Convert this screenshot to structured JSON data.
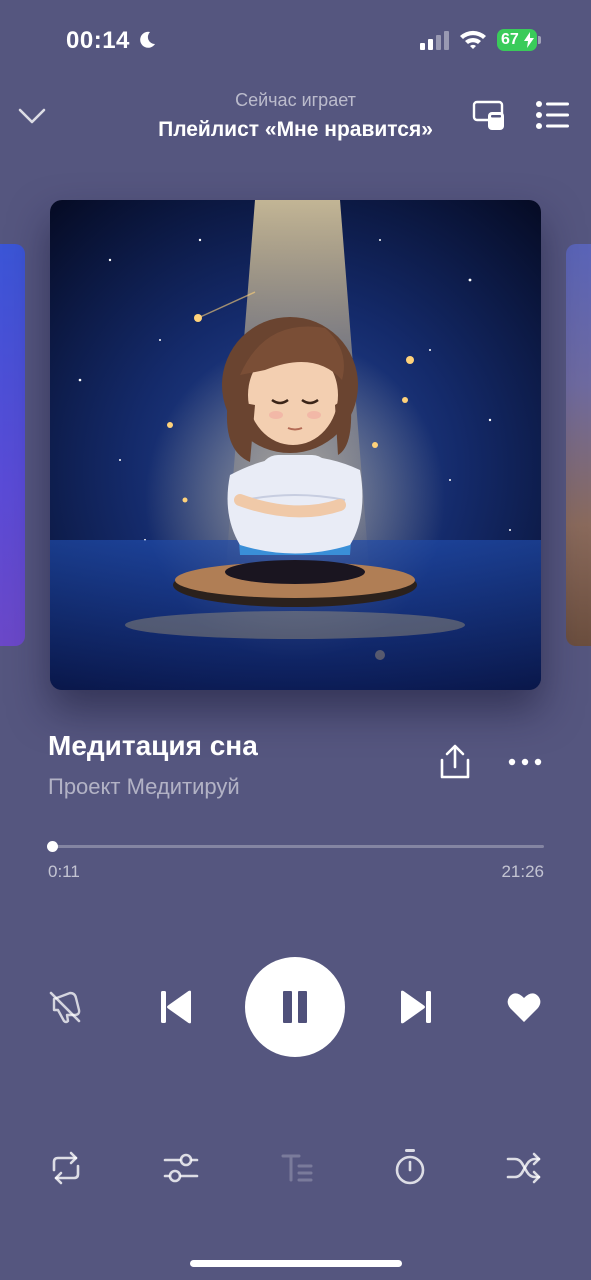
{
  "status_bar": {
    "time": "00:14",
    "battery": "67",
    "icons": [
      "moon-icon",
      "cellular-signal-icon",
      "wifi-icon",
      "battery-charging-icon"
    ]
  },
  "header": {
    "subtitle": "Сейчас играет",
    "title": "Плейлист «Мне нравится»",
    "icons": [
      "chevron-down-icon",
      "device-cast-icon",
      "queue-list-icon"
    ]
  },
  "track": {
    "title": "Медитация сна",
    "artist": "Проект Медитируй"
  },
  "progress": {
    "elapsed": "0:11",
    "total": "21:26",
    "fraction": 0.0086
  },
  "controls": {
    "state": "playing",
    "liked": true,
    "icons": [
      "dislike-icon",
      "skip-previous-icon",
      "pause-icon",
      "skip-next-icon",
      "heart-icon"
    ]
  },
  "bottom_bar": {
    "icons": [
      "repeat-icon",
      "equalizer-icon",
      "lyrics-icon",
      "sleep-timer-icon",
      "shuffle-icon"
    ],
    "lyrics_enabled": false
  },
  "colors": {
    "background": "#55567f",
    "battery": "#3acb5a",
    "accent": "#ffffff"
  }
}
